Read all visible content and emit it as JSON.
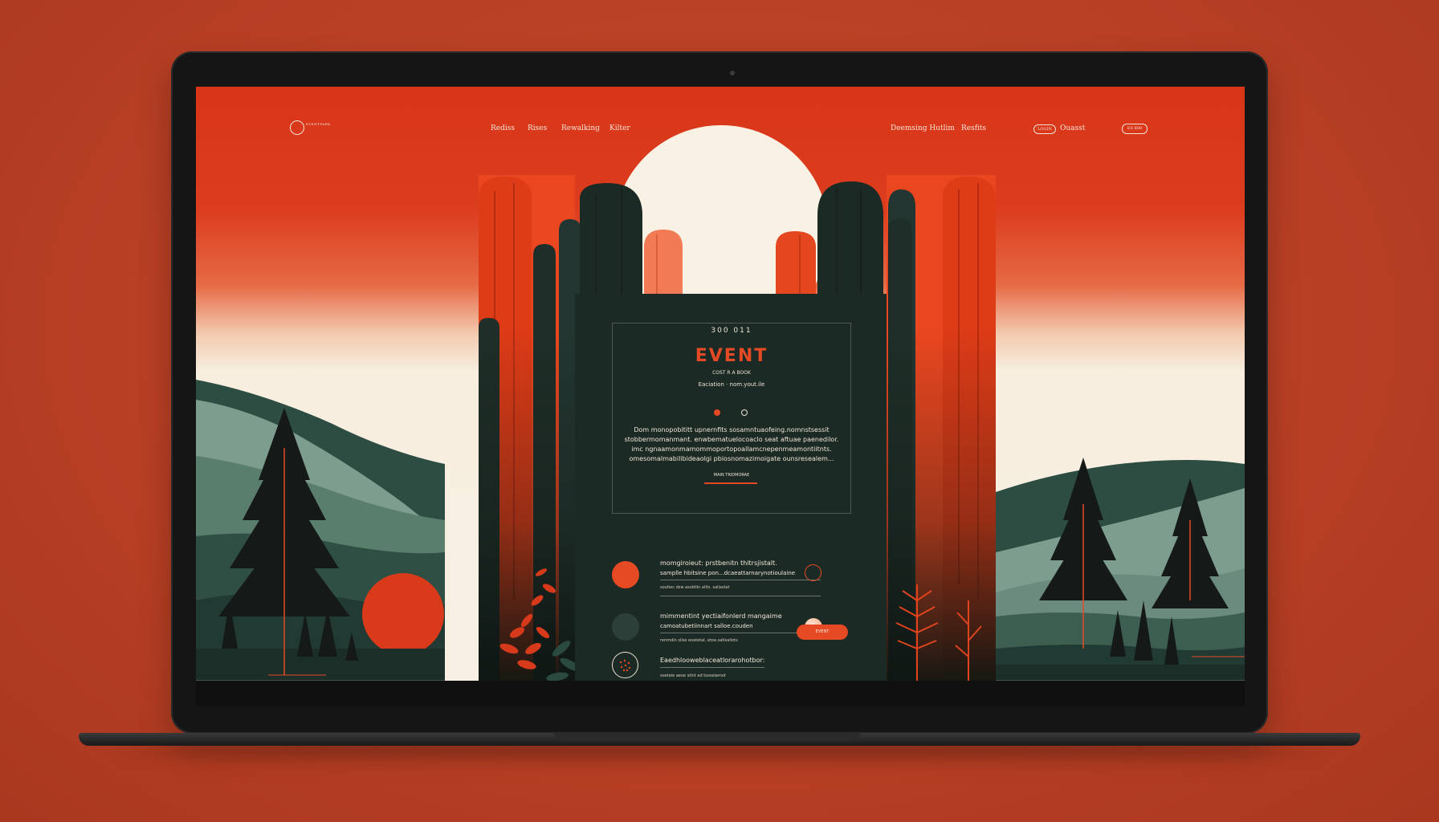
{
  "colors": {
    "background": "#b73f24",
    "accent": "#e64a24",
    "forest": "#1c2a25",
    "cream": "#f7f0e2"
  },
  "nav": {
    "logo_text": "EVENTPARK",
    "links": [
      "Rediss",
      "Rises",
      "Rewalking",
      "Kilter"
    ],
    "right_links": [
      "Deemsing Hutlim",
      "Resfits"
    ],
    "pill_small": "LOGIN",
    "pill_account": "Ouasst",
    "pill_right": "ES 808"
  },
  "card": {
    "kicker": "300 011",
    "title": "EVENT",
    "subtitle": "COST R A BOOK",
    "meta": "Eaciation  ·  nom.yout.ile",
    "paragraph": [
      "Dom monopobititt upnernfits sosamntuaofeing.nomnstsessit",
      "stobbermomanmant. enwbematuelocoaclo seat aftuae paenedilor.",
      "imc ngnaamonmamommoportopoallamcnepenmeamontiitnts.",
      "omesomalmabilibideaolgi pbiosnomazimoigate ounsresealem..."
    ],
    "link_text": "MAIN TRIDMORAE"
  },
  "events": [
    {
      "title_line1": "momgiroieut: prstbenitn thitrsjistalt.",
      "title_line2": "samplle hbitsine pon...dcaeattarnarynotioulaine",
      "meta": "soutiec dsw asoldiin allts. saliastat"
    },
    {
      "title_line1": "mimmentint yectiaifonlerd mangaime",
      "title_line2": "camoatubetiinnart salloe.couden",
      "meta": "renmdin silse eoatetal, etoe.saltsallots"
    },
    {
      "title_line1": "Eaedhlooweblaceatlorarohotbor:",
      "title_line2": "",
      "meta": "soeteie aeoe sitnt ed tsoseiamot"
    }
  ],
  "cta_label": "EVENT"
}
